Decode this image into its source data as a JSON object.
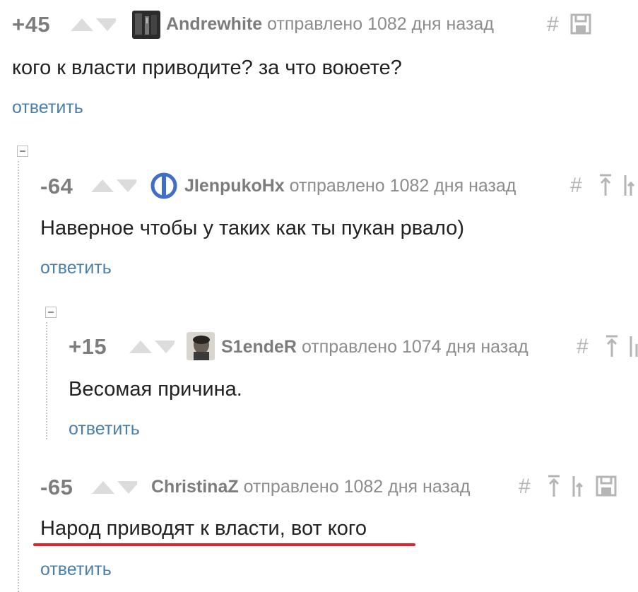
{
  "comments": [
    {
      "rating": "+45",
      "author": "Andrewhite",
      "sent": "отправлено 1082 дня назад",
      "text": "кого к власти приводите? за что воюете?",
      "reply": "ответить",
      "icons": [
        "upvote-icon",
        "downvote-icon",
        "hash-icon",
        "save-icon"
      ]
    },
    {
      "rating": "-64",
      "author": "JIenpukoHx",
      "sent": "отправлено 1082 дня назад",
      "text": "Наверное чтобы у таких как ты пукан рвало)",
      "reply": "ответить",
      "icons": [
        "upvote-icon",
        "downvote-icon",
        "hash-icon",
        "go-to-parent-icon",
        "go-to-root-icon"
      ]
    },
    {
      "rating": "+15",
      "author": "S1endeR",
      "sent": "отправлено 1074 дня назад",
      "text": "Весомая причина.",
      "reply": "ответить",
      "icons": [
        "upvote-icon",
        "downvote-icon",
        "hash-icon",
        "go-to-parent-icon",
        "go-to-root-icon"
      ]
    },
    {
      "rating": "-65",
      "author": "ChristinaZ",
      "sent": "отправлено 1082 дня назад",
      "text": "Народ приводят к власти, вот кого",
      "reply": "ответить",
      "icons": [
        "upvote-icon",
        "downvote-icon",
        "hash-icon",
        "go-to-parent-icon",
        "go-to-root-icon",
        "save-icon"
      ]
    }
  ],
  "colors": {
    "rating": "#7d7d7d",
    "author": "#7c7c7c",
    "meta": "#8c8c8c",
    "reply_link": "#4a7fac",
    "icon": "#b5b5b5",
    "highlight_underline": "#e1252c"
  }
}
